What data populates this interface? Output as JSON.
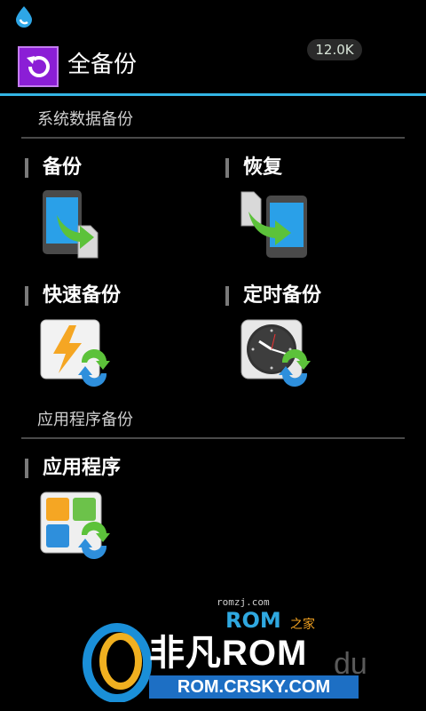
{
  "app": {
    "title": "全备份",
    "size_badge": "12.0K"
  },
  "sections": {
    "system": {
      "title": "系统数据备份",
      "tiles": [
        {
          "label": "备份",
          "icon": "phone-to-sdcard-icon"
        },
        {
          "label": "恢复",
          "icon": "sdcard-to-phone-icon"
        },
        {
          "label": "快速备份",
          "icon": "lightning-sync-icon"
        },
        {
          "label": "定时备份",
          "icon": "clock-sync-icon"
        }
      ]
    },
    "apps": {
      "title": "应用程序备份",
      "tiles": [
        {
          "label": "应用程序",
          "icon": "apps-grid-sync-icon"
        }
      ]
    }
  },
  "watermark": {
    "site_small": "romzj.com",
    "rom_small": "ROM",
    "zj_small": "之家",
    "brand": "非凡ROM",
    "url": "ROM.CRSKY.COM",
    "ghost": "du"
  },
  "colors": {
    "accent": "#33b5e5",
    "app_icon": "#8b1ed6",
    "arrow_green": "#5cc23a",
    "arrow_blue": "#2e8fdc"
  }
}
